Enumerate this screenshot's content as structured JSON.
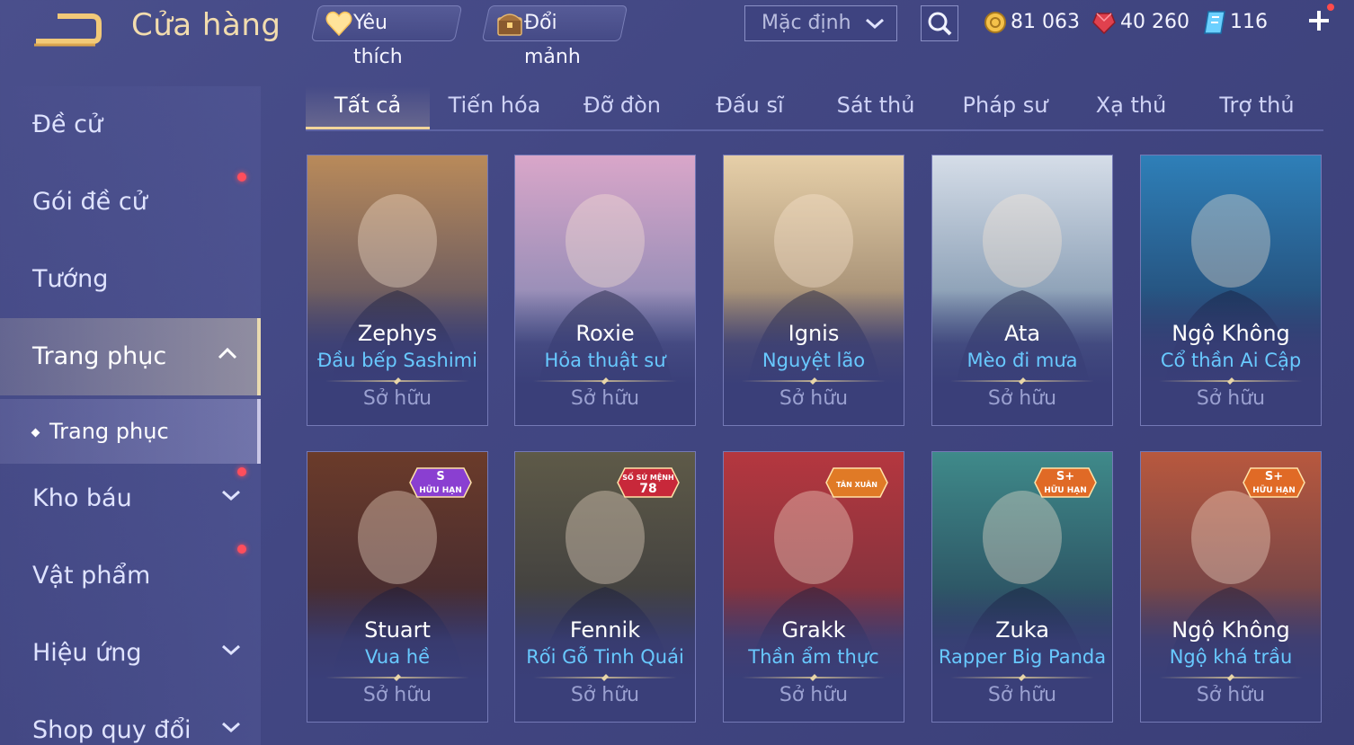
{
  "header": {
    "title": "Cửa hàng",
    "favorites_label": "Yêu thích",
    "exchange_label": "Đổi mảnh",
    "sort_value": "Mặc định"
  },
  "currencies": {
    "gold": "81 063",
    "ruby": "40 260",
    "voucher": "116"
  },
  "sidebar": {
    "items": [
      {
        "label": "Đề cử"
      },
      {
        "label": "Gói đề cử"
      },
      {
        "label": "Tướng"
      },
      {
        "label": "Trang phục"
      },
      {
        "label": "Trang phục"
      },
      {
        "label": "Kho báu"
      },
      {
        "label": "Vật phẩm"
      },
      {
        "label": "Hiệu ứng"
      },
      {
        "label": "Shop quy đổi"
      }
    ]
  },
  "tabs": [
    {
      "label": "Tất cả"
    },
    {
      "label": "Tiến hóa"
    },
    {
      "label": "Đỡ đòn"
    },
    {
      "label": "Đấu sĩ"
    },
    {
      "label": "Sát thủ"
    },
    {
      "label": "Pháp sư"
    },
    {
      "label": "Xạ thủ"
    },
    {
      "label": "Trợ thủ"
    }
  ],
  "skins": [
    {
      "hero": "Zephys",
      "skin": "Đầu bếp Sashimi",
      "status": "Sở hữu",
      "tint": "#b98a5a",
      "tint2": "#2b3566"
    },
    {
      "hero": "Roxie",
      "skin": "Hỏa thuật sư",
      "status": "Sở hữu",
      "tint": "#d9a6c9",
      "tint2": "#5d79a8"
    },
    {
      "hero": "Ignis",
      "skin": "Nguyệt lão",
      "status": "Sở hữu",
      "tint": "#e6cfa8",
      "tint2": "#6f5a4a"
    },
    {
      "hero": "Ata",
      "skin": "Mèo đi mưa",
      "status": "Sở hữu",
      "tint": "#d5dde8",
      "tint2": "#4b6a8a"
    },
    {
      "hero": "Ngộ Không",
      "skin": "Cổ thần Ai Cập",
      "status": "Sở hữu",
      "tint": "#2e7fb8",
      "tint2": "#1f2d4e"
    },
    {
      "hero": "Stuart",
      "skin": "Vua hề",
      "status": "Sở hữu",
      "tint": "#6b3b2a",
      "tint2": "#2a2035",
      "badge": {
        "top": "S",
        "bottom": "HỮU HẠN",
        "color": "#8a3fd1"
      }
    },
    {
      "hero": "Fennik",
      "skin": "Rối Gỗ Tinh Quái",
      "status": "Sở hữu",
      "tint": "#5e5a48",
      "tint2": "#2b2c38",
      "badge": {
        "top": "SỐ SỨ MỆNH",
        "bottom": "78",
        "color": "#c8283a"
      }
    },
    {
      "hero": "Grakk",
      "skin": "Thần ẩm thực",
      "status": "Sở hữu",
      "tint": "#b5373f",
      "tint2": "#5a2f3c",
      "badge": {
        "top": "TÂN XUÂN",
        "bottom": "",
        "color": "#e07a26"
      }
    },
    {
      "hero": "Zuka",
      "skin": "Rapper Big Panda",
      "status": "Sở hữu",
      "tint": "#3f8a8a",
      "tint2": "#1d2744",
      "badge": {
        "top": "S+",
        "bottom": "HỮU HẠN",
        "color": "#e06a26"
      }
    },
    {
      "hero": "Ngộ Không",
      "skin": "Ngộ khá trầu",
      "status": "Sở hữu",
      "tint": "#b8583e",
      "tint2": "#3b3550",
      "badge": {
        "top": "S+",
        "bottom": "HỮU HẠN",
        "color": "#e06a26"
      }
    }
  ]
}
